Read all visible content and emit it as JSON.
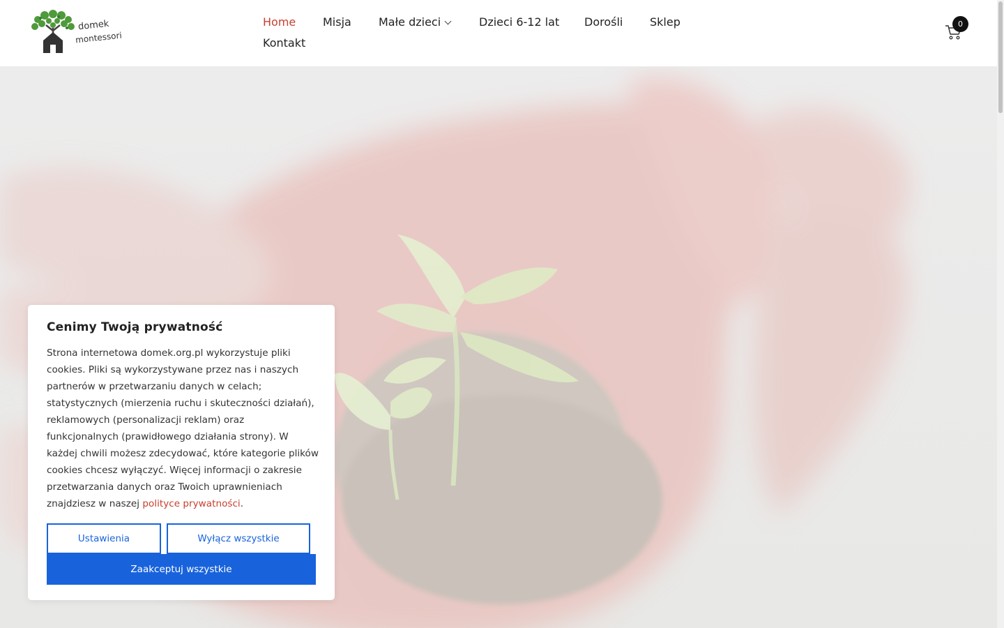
{
  "brand": {
    "logo_line1": "domek",
    "logo_line2": "montessori"
  },
  "nav": {
    "items": [
      {
        "label": "Home",
        "active": true
      },
      {
        "label": "Misja"
      },
      {
        "label": "Małe dzieci",
        "has_dropdown": true
      },
      {
        "label": "Dzieci 6-12 lat"
      },
      {
        "label": "Dorośli"
      },
      {
        "label": "Sklep"
      },
      {
        "label": "Kontakt"
      }
    ]
  },
  "cart": {
    "count": "0",
    "icon": "cart-icon"
  },
  "cookie_banner": {
    "title": "Cenimy Twoją prywatność",
    "body": "Strona internetowa domek.org.pl wykorzystuje pliki cookies. Pliki są wykorzystywane przez nas i naszych partnerów w przetwarzaniu danych w celach; statystycznych (mierzenia ruchu i skuteczności działań), reklamowych (personalizacji reklam) oraz funkcjonalnych (prawidłowego działania strony). W każdej chwili możesz zdecydować, które kategorie plików cookies chcesz wyłączyć. Więcej informacji o zakresie przetwarzania danych oraz Twoich uprawnieniach znajdziesz w naszej ",
    "link_text": "polityce prywatności",
    "trailing": ".",
    "settings_button": "Ustawienia",
    "reject_button": "Wyłącz wszystkie",
    "accept_button": "Zaakceptuj wszystkie"
  },
  "colors": {
    "accent": "#c7402f",
    "primary_button": "#1863dc"
  }
}
